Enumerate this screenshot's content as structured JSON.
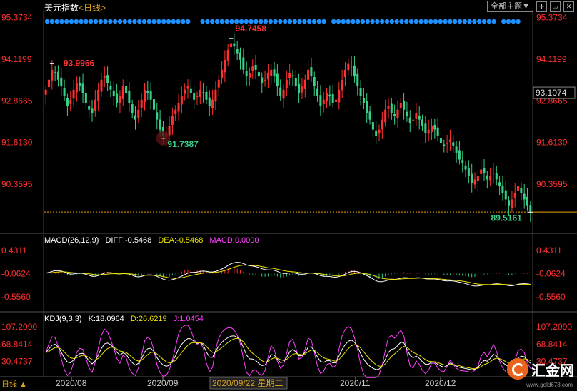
{
  "header": {
    "title": "美元指数",
    "period": "<日线>",
    "theme_button": "全部主题▼",
    "icons": [
      "crosshair-icon",
      "minimize-icon",
      "close-icon"
    ]
  },
  "period_corner": "日线 ▲",
  "logo": {
    "text": "汇金网",
    "url": "www.gold678.com"
  },
  "colors": {
    "up": "#ff3030",
    "down": "#39d08a",
    "dif": "#ffffff",
    "dea": "#e8e000",
    "k": "#ffffff",
    "d": "#e8e000",
    "j": "#ff40ff",
    "axis_label": "#ff3030",
    "event_dots": "#1e90ff",
    "last_price_line": "#e8a000"
  },
  "chart_data": [
    {
      "type": "candlestick",
      "title": "美元指数",
      "y_ticks": [
        "95.3734",
        "94.1199",
        "92.8665",
        "91.6130",
        "90.3595"
      ],
      "ylim": [
        88.9,
        95.6
      ],
      "last_price_label": "93.1074",
      "last_close": 89.52,
      "annotations": [
        {
          "text": "93.9966",
          "value": 93.9966
        },
        {
          "text": "94.7458",
          "value": 94.7458
        },
        {
          "text": "91.7387",
          "value": 91.7387
        },
        {
          "text": "89.5161",
          "value": 89.5161
        }
      ],
      "x_ticks": [
        "2020/08",
        "2020/09",
        "2020/09/22 星期二",
        "2020/11",
        "2020/12"
      ],
      "closes": [
        93.2,
        93.5,
        93.8,
        93.7,
        93.5,
        93.3,
        93.0,
        92.7,
        92.9,
        93.2,
        93.4,
        93.3,
        93.1,
        92.8,
        92.6,
        92.5,
        92.9,
        93.2,
        93.5,
        93.6,
        93.4,
        93.2,
        93.0,
        92.8,
        93.0,
        93.3,
        93.1,
        92.8,
        92.5,
        92.3,
        92.6,
        92.9,
        93.2,
        93.1,
        92.9,
        92.6,
        92.3,
        92.0,
        91.8,
        91.9,
        92.1,
        92.4,
        92.6,
        92.8,
        93.0,
        93.2,
        93.3,
        93.1,
        92.9,
        93.0,
        93.2,
        93.1,
        92.9,
        92.7,
        92.9,
        93.2,
        93.5,
        93.8,
        94.1,
        94.4,
        94.6,
        94.5,
        94.3,
        94.1,
        93.8,
        93.6,
        93.7,
        93.9,
        93.8,
        93.6,
        93.4,
        93.5,
        93.7,
        93.8,
        93.6,
        93.3,
        93.0,
        93.2,
        93.5,
        93.7,
        93.6,
        93.3,
        93.1,
        93.3,
        93.5,
        93.8,
        93.6,
        93.3,
        93.0,
        92.7,
        92.9,
        93.1,
        93.0,
        92.8,
        92.9,
        93.2,
        93.5,
        93.8,
        94.0,
        93.9,
        93.6,
        93.3,
        93.0,
        92.8,
        92.5,
        92.3,
        92.0,
        91.8,
        92.0,
        92.3,
        92.6,
        92.7,
        92.5,
        92.4,
        92.6,
        92.8,
        92.6,
        92.4,
        92.2,
        92.3,
        92.5,
        92.3,
        92.1,
        91.9,
        92.0,
        92.1,
        92.0,
        91.8,
        91.6,
        91.5,
        91.6,
        91.7,
        91.5,
        91.3,
        91.1,
        91.0,
        90.8,
        90.6,
        90.4,
        90.5,
        90.6,
        90.8,
        90.7,
        90.5,
        90.6,
        90.7,
        90.5,
        90.3,
        90.1,
        89.9,
        89.7,
        89.9,
        90.1,
        90.3,
        90.1,
        89.9,
        89.7,
        89.52
      ]
    },
    {
      "type": "macd",
      "legend": [
        {
          "text": "MACD(26,12,9)",
          "color": "#ffffff"
        },
        {
          "text": "DIFF:-0.5468",
          "color": "#ffffff"
        },
        {
          "text": "DEA:-0.5468",
          "color": "#e8e000"
        },
        {
          "text": "MACD:0.0000",
          "color": "#ff40ff"
        }
      ],
      "y_ticks": [
        "0.4311",
        "-0.0624",
        "-0.5560"
      ],
      "ylim": [
        -0.8,
        0.6
      ]
    },
    {
      "type": "kdj",
      "legend": [
        {
          "text": "KDJ(9,3,3)",
          "color": "#ffffff"
        },
        {
          "text": "K:18.0964",
          "color": "#ffffff"
        },
        {
          "text": "D:26.6219",
          "color": "#e8e000"
        },
        {
          "text": "J:1.0454",
          "color": "#ff40ff"
        }
      ],
      "y_ticks": [
        "107.2090",
        "68.8414",
        "30.4737"
      ],
      "ylim": [
        0,
        120
      ]
    }
  ]
}
